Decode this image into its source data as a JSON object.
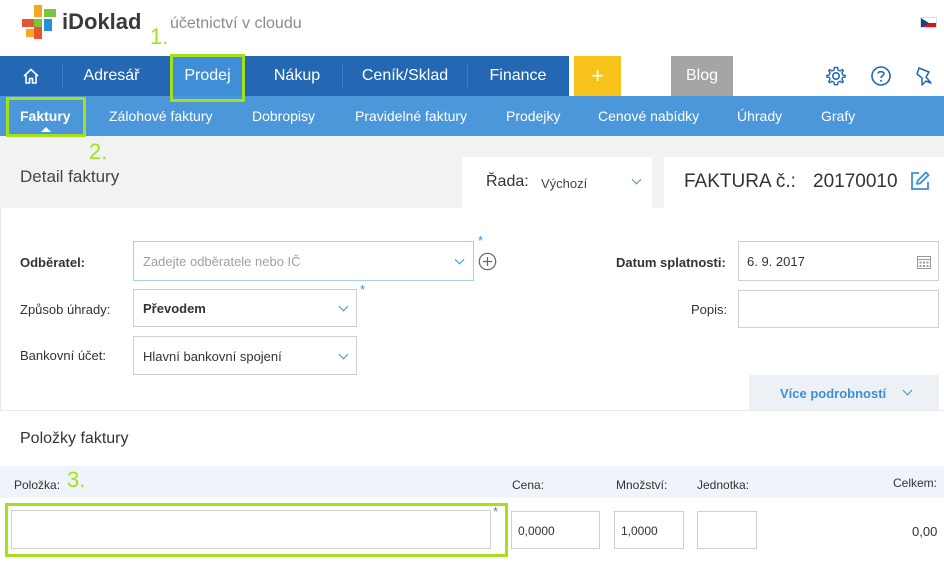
{
  "brand": {
    "name": "iDoklad",
    "tagline": "účetnictví v cloudu"
  },
  "main_nav": {
    "items": [
      "Adresář",
      "Prodej",
      "Nákup",
      "Ceník/Sklad",
      "Finance"
    ],
    "plus": "+",
    "blog": "Blog"
  },
  "sub_nav": {
    "items": [
      "Faktury",
      "Zálohové faktury",
      "Dobropisy",
      "Pravidelné faktury",
      "Prodejky",
      "Cenové nabídky",
      "Úhrady",
      "Grafy"
    ]
  },
  "steps": [
    "1.",
    "2.",
    "3."
  ],
  "header": {
    "title": "Detail faktury",
    "rada_label": "Řada:",
    "rada_value": "Výchozí",
    "faktura_label": "FAKTURA č.:",
    "faktura_number": "20170010"
  },
  "form": {
    "odberatel_label": "Odběratel:",
    "odberatel_placeholder": "Zadejte odběratele nebo IČ",
    "zpusob_label": "Způsob úhrady:",
    "zpusob_value": "Převodem",
    "ucet_label": "Bankovní účet:",
    "ucet_value": "Hlavní bankovní spojení",
    "datum_label": "Datum splatnosti:",
    "datum_value": "6. 9. 2017",
    "popis_label": "Popis:",
    "more_label": "Více podrobností",
    "required_mark": "*"
  },
  "items": {
    "title": "Položky faktury",
    "columns": {
      "polozka": "Položka:",
      "cena": "Cena:",
      "mnozstvi": "Množství:",
      "jednotka": "Jednotka:",
      "celkem": "Celkem:"
    },
    "row": {
      "cena": "0,0000",
      "mnozstvi": "1,0000",
      "celkem": "0,00"
    }
  },
  "colors": {
    "nav_blue": "#2467b3",
    "sub_blue": "#4b97d9",
    "active_blue": "#3e8fd6",
    "plus_yellow": "#f7c21a",
    "highlight_green": "#a4e01c"
  }
}
